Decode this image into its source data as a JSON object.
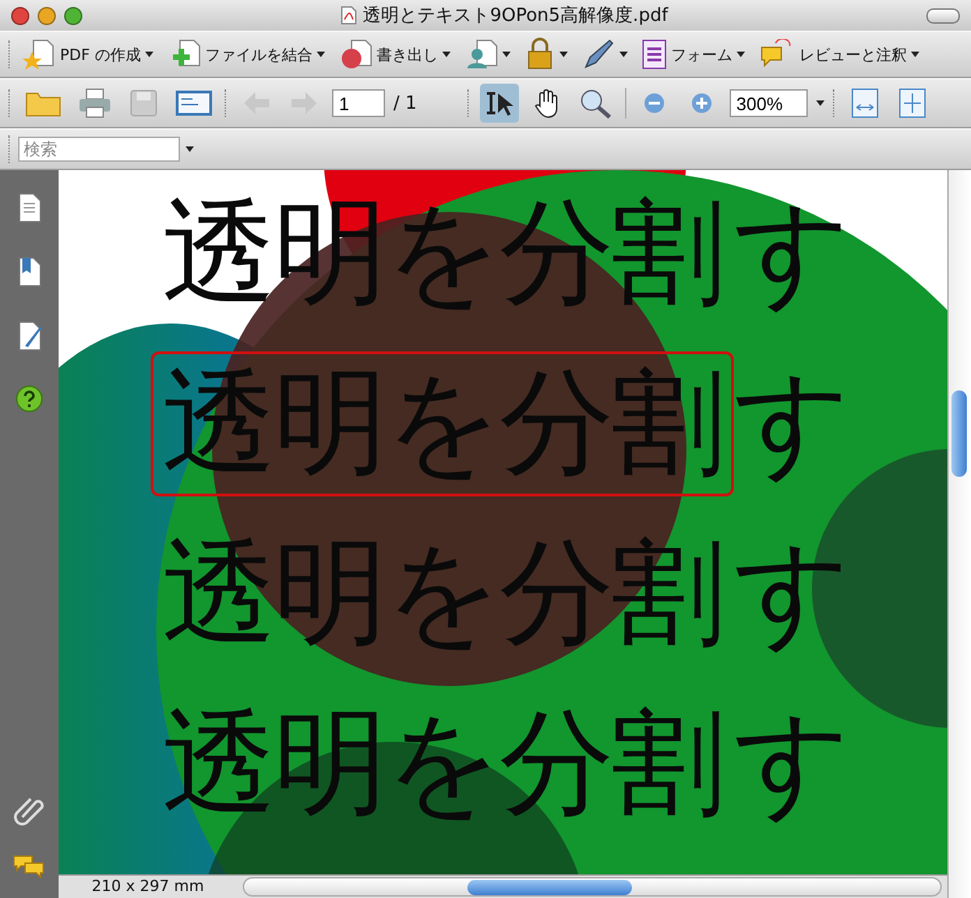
{
  "window": {
    "title": "透明とテキスト9OPon5高解像度.pdf"
  },
  "task_toolbar": [
    {
      "kind": "menu",
      "label": "PDF の作成"
    },
    {
      "kind": "menu",
      "label": "ファイルを結合"
    },
    {
      "kind": "menu",
      "label": "書き出し"
    },
    {
      "kind": "icon-menu"
    },
    {
      "kind": "icon-menu"
    },
    {
      "kind": "icon-menu"
    },
    {
      "kind": "menu",
      "label": "フォーム"
    },
    {
      "kind": "menu",
      "label": "レビューと注釈"
    }
  ],
  "nav_toolbar": {
    "page_value": "1",
    "page_total": "/ 1",
    "zoom": "300%",
    "tools": [
      {
        "selected": true
      },
      {
        "selected": false
      }
    ]
  },
  "search": {
    "placeholder": "検索"
  },
  "document": {
    "rows": [
      {
        "text": "透明を分割",
        "tail": "す",
        "selected": false
      },
      {
        "text": "透明を分割",
        "tail": "す",
        "selected": true
      },
      {
        "text": "透明を分割",
        "tail": "す",
        "selected": false
      },
      {
        "text": "透明を分割",
        "tail": "す",
        "selected": false
      }
    ]
  },
  "status_bar": {
    "page_size": "210 x 297 mm"
  }
}
